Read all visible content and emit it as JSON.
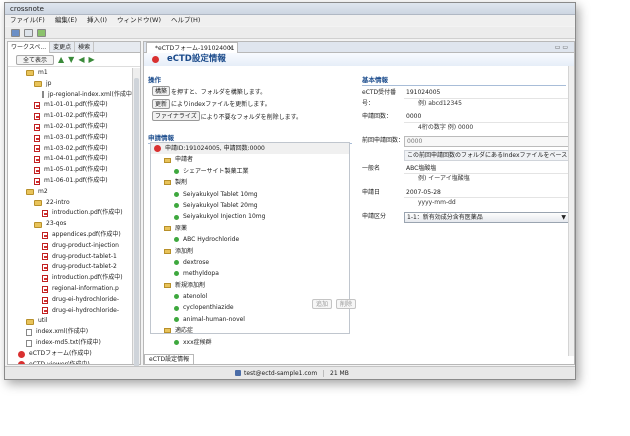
{
  "window": {
    "title": "crossnote"
  },
  "menu": [
    "ファイル(F)",
    "編集(E)",
    "挿入(I)",
    "ウィンドウ(W)",
    "ヘルプ(H)"
  ],
  "left_panel": {
    "tabs": [
      "ワークスペ...",
      "変更点",
      "検索"
    ],
    "filter_button": "全て表示",
    "tree": [
      {
        "label": "m1",
        "type": "folder",
        "indent": 2
      },
      {
        "label": "jp",
        "type": "folder",
        "indent": 3
      },
      {
        "label": "jp-regional-index.xml(作成中)",
        "type": "file",
        "indent": 4
      },
      {
        "label": "m1-01-01.pdf(作成中)",
        "type": "pdf",
        "indent": 3
      },
      {
        "label": "m1-01-02.pdf(作成中)",
        "type": "pdf",
        "indent": 3
      },
      {
        "label": "m1-02-01.pdf(作成中)",
        "type": "pdf",
        "indent": 3
      },
      {
        "label": "m1-03-01.pdf(作成中)",
        "type": "pdf",
        "indent": 3
      },
      {
        "label": "m1-03-02.pdf(作成中)",
        "type": "pdf",
        "indent": 3
      },
      {
        "label": "m1-04-01.pdf(作成中)",
        "type": "pdf",
        "indent": 3
      },
      {
        "label": "m1-05-01.pdf(作成中)",
        "type": "pdf",
        "indent": 3
      },
      {
        "label": "m1-06-01.pdf(作成中)",
        "type": "pdf",
        "indent": 3
      },
      {
        "label": "m2",
        "type": "folder",
        "indent": 2
      },
      {
        "label": "22-intro",
        "type": "folder",
        "indent": 3
      },
      {
        "label": "introduction.pdf(作成中)",
        "type": "pdf",
        "indent": 4
      },
      {
        "label": "23-qos",
        "type": "folder",
        "indent": 3
      },
      {
        "label": "appendices.pdf(作成中)",
        "type": "pdf",
        "indent": 4
      },
      {
        "label": "drug-product-injection",
        "type": "pdf",
        "indent": 4
      },
      {
        "label": "drug-product-tablet-1",
        "type": "pdf",
        "indent": 4
      },
      {
        "label": "drug-product-tablet-2",
        "type": "pdf",
        "indent": 4
      },
      {
        "label": "introduction.pdf(作成中)",
        "type": "pdf",
        "indent": 4
      },
      {
        "label": "regional-information.p",
        "type": "pdf",
        "indent": 4
      },
      {
        "label": "drug-ei-hydrochloride-",
        "type": "pdf",
        "indent": 4
      },
      {
        "label": "drug-ei-hydrochloride-",
        "type": "pdf",
        "indent": 4
      },
      {
        "label": "util",
        "type": "folder",
        "indent": 2
      },
      {
        "label": "index.xml(作成中)",
        "type": "file",
        "indent": 2
      },
      {
        "label": "index-md5.txt(作成中)",
        "type": "file",
        "indent": 2
      },
      {
        "label": "eCTDフォーム(作成中)",
        "type": "ectd",
        "indent": 1
      },
      {
        "label": "eCTD viewer(作成中)",
        "type": "ectd",
        "indent": 1
      }
    ]
  },
  "editor": {
    "tab_label": "*eCTDフォーム-191024001",
    "heading": "eCTD設定情報",
    "operations": {
      "title": "操作",
      "rows": [
        {
          "button": "構築",
          "text": "を押すと、フォルダを構築します。"
        },
        {
          "button": "更新",
          "text": "によりindexファイルを更新します。"
        },
        {
          "button": "ファイナライズ",
          "text": "により不要なフォルダを削除します。"
        }
      ]
    },
    "application": {
      "title": "申請情報",
      "tree": [
        {
          "label": "申請ID:191024005, 申請回数:0000",
          "kind": "root",
          "indent": 0
        },
        {
          "label": "申請者",
          "kind": "folder",
          "indent": 1
        },
        {
          "label": "シェアーサイト製薬工業",
          "kind": "item",
          "indent": 2
        },
        {
          "label": "製剤",
          "kind": "folder",
          "indent": 1
        },
        {
          "label": "Seiyakukyol Tablet 10mg",
          "kind": "item",
          "indent": 2
        },
        {
          "label": "Seiyakukyol Tablet 20mg",
          "kind": "item",
          "indent": 2
        },
        {
          "label": "Seiyakukyol Injection 10mg",
          "kind": "item",
          "indent": 2
        },
        {
          "label": "原薬",
          "kind": "folder",
          "indent": 1
        },
        {
          "label": "ABC Hydrochloride",
          "kind": "item",
          "indent": 2
        },
        {
          "label": "添加剤",
          "kind": "folder",
          "indent": 1
        },
        {
          "label": "dextrose",
          "kind": "item",
          "indent": 2
        },
        {
          "label": "methyldopa",
          "kind": "item",
          "indent": 2
        },
        {
          "label": "新規添加剤",
          "kind": "folder",
          "indent": 1
        },
        {
          "label": "atenolol",
          "kind": "item",
          "indent": 2
        },
        {
          "label": "cyclopenthiazide",
          "kind": "item",
          "indent": 2
        },
        {
          "label": "animal-human-novel",
          "kind": "item",
          "indent": 2
        },
        {
          "label": "適応症",
          "kind": "folder",
          "indent": 1
        },
        {
          "label": "xxx症候群",
          "kind": "item",
          "indent": 2
        }
      ],
      "add_button": "追加",
      "delete_button": "削除"
    },
    "basic": {
      "title": "基本情報",
      "fields": [
        {
          "label": "eCTD受付番号：",
          "value": "191024005",
          "hint": "例) abcd12345"
        },
        {
          "label": "申請回数：",
          "value": "0000",
          "hint": "4桁の数字 例) 0000"
        },
        {
          "label": "前回申請回数：",
          "value": "0000",
          "style": "box"
        },
        {
          "label": "",
          "value": "この前回申請回数のフォルダにあるIndexファイルをベース",
          "style": "wide"
        },
        {
          "label": "一般名",
          "value": "ABC塩酸塩",
          "hint": "例) イーアイ塩酸塩"
        },
        {
          "label": "申請日",
          "value": "2007-05-28",
          "hint": "yyyy-mm-dd"
        },
        {
          "label": "申請区分",
          "value": "1-1：新有効成分含有医薬品",
          "style": "combo"
        }
      ]
    },
    "bottom_tab": "eCTD設定情報"
  },
  "status": {
    "email": "test@ectd-sample1.com",
    "memory": "21 MB"
  }
}
